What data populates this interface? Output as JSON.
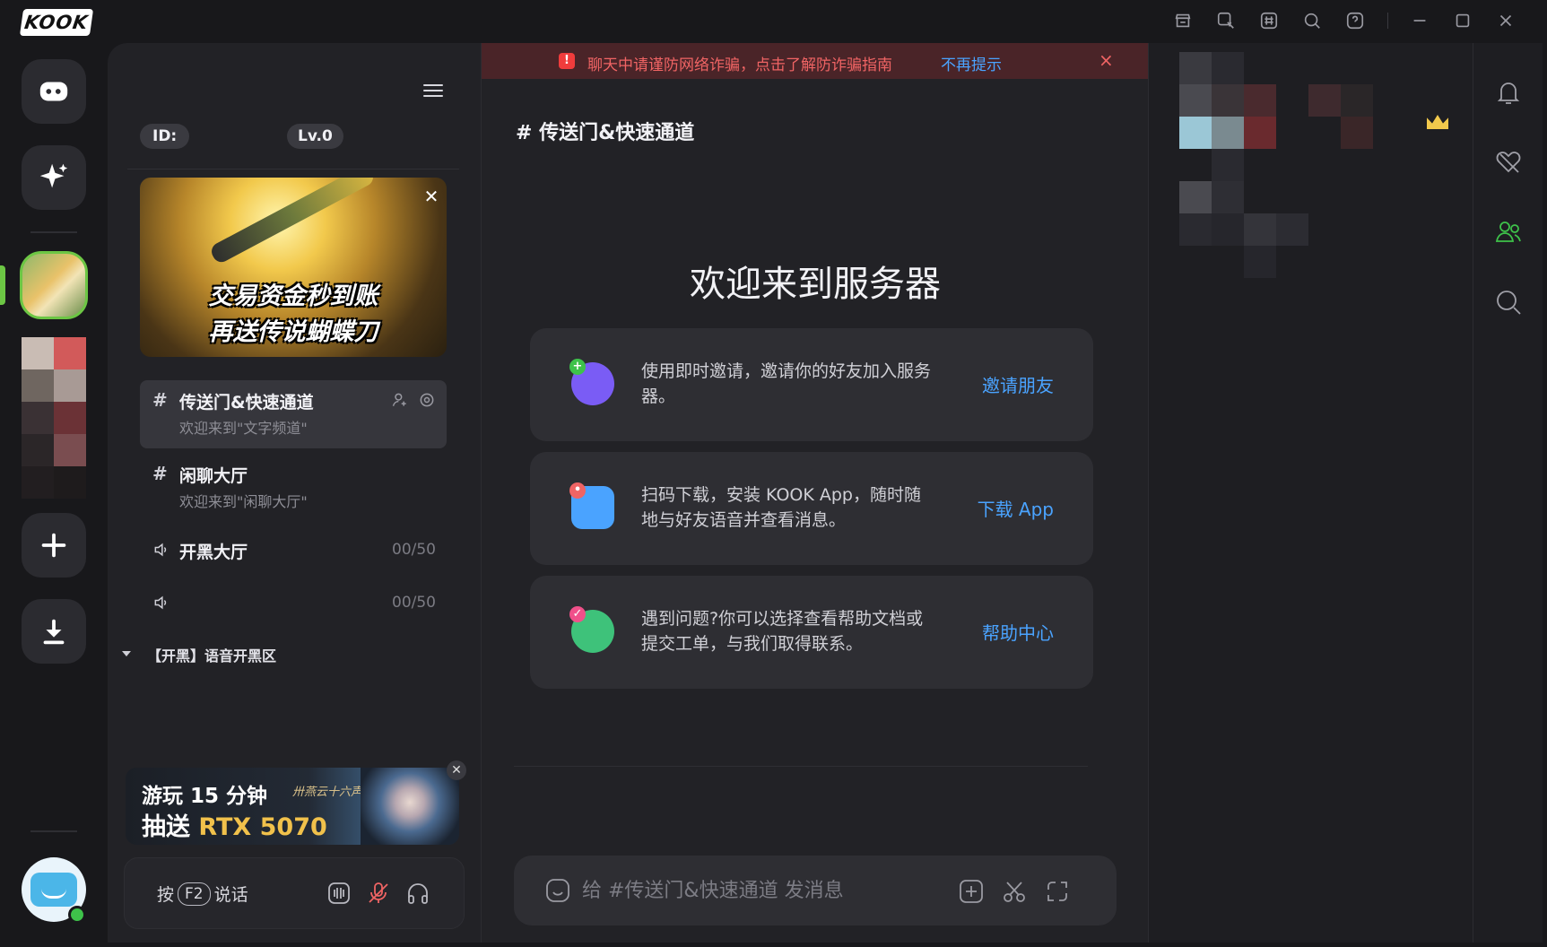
{
  "app": {
    "logo_text": "KOOK"
  },
  "titlebar": {
    "icons": [
      "shop-icon",
      "sticker-icon",
      "channel-grid-icon",
      "search-icon",
      "help-icon",
      "minimize-icon",
      "maximize-icon",
      "close-icon"
    ]
  },
  "rail": {
    "buttons": [
      "gamepad-icon",
      "sparkle-icon",
      "add-server-icon",
      "download-icon"
    ]
  },
  "panel": {
    "id_label": "ID:",
    "level_label": "Lv.0",
    "banner": {
      "line1": "交易资金秒到账",
      "line2": "再送传说蝴蝶刀"
    },
    "channels": [
      {
        "name": "传送门&快速通道",
        "subtitle": "欢迎来到\"文字频道\"",
        "type": "text",
        "active": true
      },
      {
        "name": "闲聊大厅",
        "subtitle": "欢迎来到\"闲聊大厅\"",
        "type": "text",
        "active": false
      },
      {
        "name": "开黑大厅",
        "count": "00/50",
        "type": "voice"
      },
      {
        "name": "",
        "count": "00/50",
        "type": "voice"
      }
    ],
    "category": "【开黑】语音开黑区",
    "ad": {
      "line1": "游玩 15 分钟",
      "line2_prefix": "抽送 ",
      "line2_highlight": "RTX 5070",
      "brand": "卅燕云十六声"
    },
    "voice": {
      "press": "按",
      "key": "F2",
      "talk": "说话"
    }
  },
  "main": {
    "alert": {
      "text": "聊天中请谨防网络诈骗，点击了解防诈骗指南",
      "link": "不再提示",
      "close": "×"
    },
    "channel_title": "传送门&快速通道",
    "welcome": "欢迎来到服务器",
    "cards": [
      {
        "text": "使用即时邀请，邀请你的好友加入服务器。",
        "action": "邀请朋友",
        "color": "#7a5cf5"
      },
      {
        "text": "扫码下载，安装 KOOK App，随时随地与好友语音并查看消息。",
        "action": "下载 App",
        "color": "#4aa3ff"
      },
      {
        "text": "遇到问题?你可以选择查看帮助文档或提交工单，与我们取得联系。",
        "action": "帮助中心",
        "color": "#3ec27a"
      }
    ],
    "composer": {
      "placeholder": "给 #传送门&快速通道 发消息"
    }
  },
  "colors": {
    "accent_green": "#3ec24a",
    "link_blue": "#4aa3ff",
    "alert_red": "#f06464"
  }
}
